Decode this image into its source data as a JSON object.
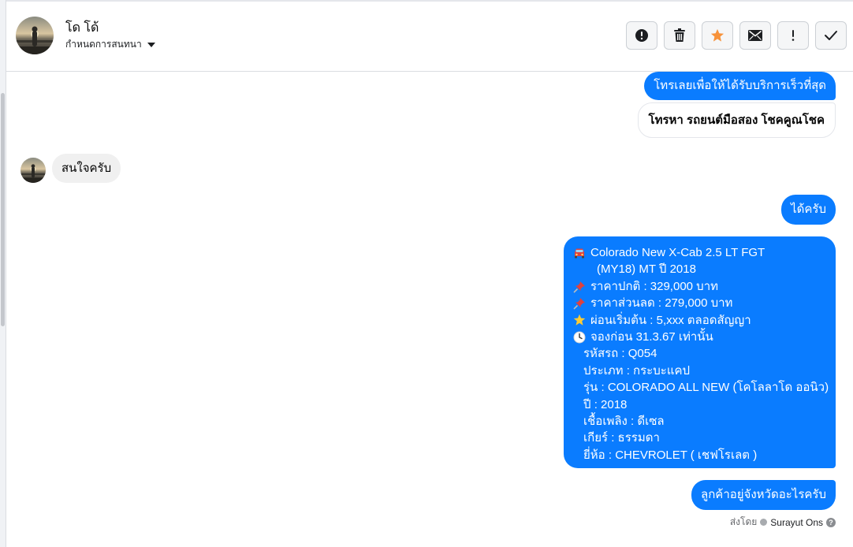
{
  "header": {
    "contact_name": "โด โด้",
    "assign_label": "กำหนดการสนทนา",
    "actions": [
      {
        "name": "report-spam-button",
        "icon": "alert-circle-icon"
      },
      {
        "name": "delete-button",
        "icon": "trash-icon"
      },
      {
        "name": "star-button",
        "icon": "star-icon"
      },
      {
        "name": "mark-unread-button",
        "icon": "envelope-icon"
      },
      {
        "name": "follow-up-button",
        "icon": "exclamation-icon"
      },
      {
        "name": "mark-done-button",
        "icon": "checkmark-icon"
      }
    ]
  },
  "messages": {
    "m1": "โทรเลยเพื่อให้ได้รับบริการเร็วที่สุด",
    "m2": "โทรหา รถยนต์มือสอง โชคคูณโชค",
    "m3": "สนใจครับ",
    "m4": "ได้ครับ",
    "m6": "ลูกค้าอยู่จังหวัดอะไรครับ"
  },
  "car_card": {
    "title_line1": "Colorado New X-Cab 2.5 LT FGT",
    "title_line2": "(MY18) MT ปี 2018",
    "normal_price": "ราคาปกติ : 329,000 บาท",
    "discount_price": "ราคาส่วนลด : 279,000 บาท",
    "installment": "ผ่อนเริ่มต้น : 5,xxx ตลอดสัญญา",
    "reserve": "จองก่อน 31.3.67 เท่านั้น",
    "code": "รหัสรถ : Q054",
    "type": "ประเภท : กระบะแคป",
    "model": "รุ่น : COLORADO ALL NEW (โคโลลาโด ออนิว)",
    "year": "ปี : 2018",
    "fuel": "เชื้อเพลิง : ดีเซล",
    "gear": "เกียร์ : ธรรมดา",
    "brand": "ยี่ห้อ : CHEVROLET ( เชฟโรเลต )"
  },
  "sent_by": {
    "label": "ส่งโดย",
    "name": "Surayut Ons",
    "help": "?"
  },
  "colors": {
    "outgoing_bubble": "#0a7cff",
    "incoming_bubble": "#f0f0f0",
    "star": "#f7923a"
  }
}
